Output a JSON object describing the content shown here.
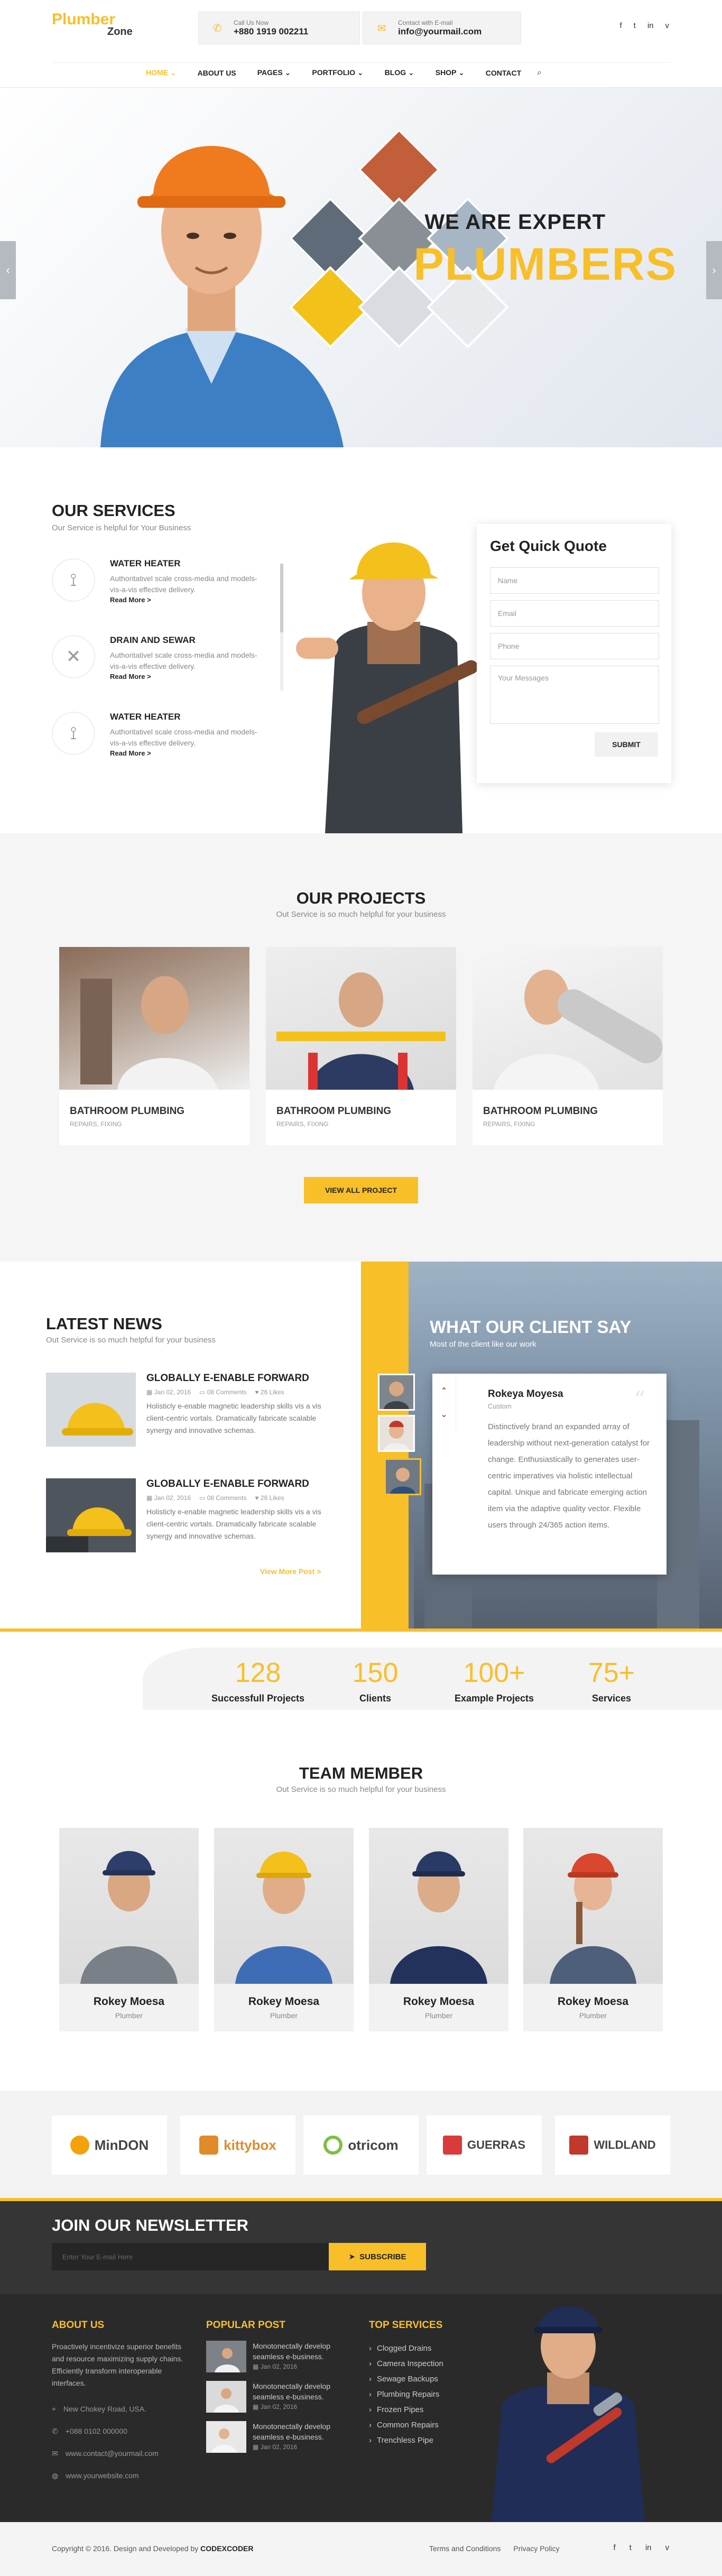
{
  "header": {
    "logo_line1": "Plumber",
    "logo_line2": "Zone",
    "call_label": "Call Us Now",
    "call_value": "+880 1919 002211",
    "mail_label": "Contact with E-mail",
    "mail_value": "info@yourmail.com",
    "social": [
      "f",
      "t",
      "in",
      "v"
    ]
  },
  "nav": {
    "items": [
      "HOME",
      "ABOUT US",
      "PAGES",
      "PORTFOLIO",
      "BLOG",
      "SHOP",
      "CONTACT"
    ],
    "dropdown_marks": [
      "⌄",
      "⌄",
      "⌄",
      "⌄",
      "⌄"
    ]
  },
  "hero": {
    "title_small": "WE ARE EXPERT",
    "title_big": "PLUMBERS",
    "prev": "‹",
    "next": "›"
  },
  "services": {
    "title": "OUR SERVICES",
    "subtitle": "Our Service is helpful for Your Business",
    "items": [
      {
        "title": "WATER HEATER",
        "text": "Authoritativel scale cross-media and models-vis-a-vis effective delivery.",
        "link": "Read More >"
      },
      {
        "title": "DRAIN AND SEWAR",
        "text": "Authoritativel scale cross-media and models-vis-a-vis effective delivery.",
        "link": "Read More >"
      },
      {
        "title": "WATER HEATER",
        "text": "Authoritativel scale cross-media and models-vis-a-vis effective delivery.",
        "link": "Read More >"
      }
    ]
  },
  "quote": {
    "title": "Get Quick Quote",
    "placeholders": [
      "Name",
      "Email",
      "Phone",
      "Your Messages"
    ],
    "submit": "SUBMIT"
  },
  "projects": {
    "title": "OUR PROJECTS",
    "subtitle": "Out Service is so much helpful for your business",
    "items": [
      {
        "title": "BATHROOM PLUMBING",
        "category": "REPAIRS, FIXING"
      },
      {
        "title": "BATHROOM PLUMBING",
        "category": "REPAIRS, FIXING"
      },
      {
        "title": "BATHROOM PLUMBING",
        "category": "REPAIRS, FIXING"
      }
    ],
    "button": "VIEW ALL PROJECT"
  },
  "news": {
    "title": "LATEST NEWS",
    "subtitle": "Out Service is so much helpful for your business",
    "items": [
      {
        "title": "GLOBALLY E-ENABLE FORWARD",
        "date": "Jan 02, 2016",
        "comments": "08 Comments",
        "likes": "26 Likes",
        "text": "Holisticly e-enable magnetic leadership skills vis a vis client-centric vortals. Dramatically fabricate scalable synergy and innovative schemas."
      },
      {
        "title": "GLOBALLY E-ENABLE FORWARD",
        "date": "Jan 02, 2016",
        "comments": "08 Comments",
        "likes": "26 Likes",
        "text": "Holisticly e-enable magnetic leadership skills vis a vis client-centric vortals. Dramatically fabricate scalable synergy and innovative schemas."
      }
    ],
    "view_more": "View More Post >"
  },
  "testimonial": {
    "title": "WHAT OUR CLIENT SAY",
    "subtitle": "Most of the client like our work",
    "name": "Rokeya Moyesa",
    "role": "Custom",
    "text": "Distinctively brand an expanded array of leadership without next-generation catalyst for change. Enthusiastically to generates user-centric imperatives via holistic intellectual capital. Unique and fabricate emerging action item via the adaptive quality vector. Flexible users through 24/365 action items.",
    "quote_mark": "“",
    "up": "⌃",
    "down": "⌄"
  },
  "counters": [
    {
      "number": "128",
      "label": "Successfull Projects"
    },
    {
      "number": "150",
      "label": "Clients"
    },
    {
      "number": "100+",
      "label": "Example Projects"
    },
    {
      "number": "75+",
      "label": "Services"
    }
  ],
  "team": {
    "title": "TEAM MEMBER",
    "subtitle": "Out Service is so much helpful for your business",
    "members": [
      {
        "name": "Rokey Moesa",
        "role": "Plumber"
      },
      {
        "name": "Rokey Moesa",
        "role": "Plumber"
      },
      {
        "name": "Rokey Moesa",
        "role": "Plumber"
      },
      {
        "name": "Rokey Moesa",
        "role": "Plumber"
      }
    ]
  },
  "partners": [
    "MinDON",
    "kittybox",
    "otricom",
    "GUERRAS",
    "WILDLAND"
  ],
  "footer": {
    "newsletter_title": "JOIN OUR NEWSLETTER",
    "newsletter_placeholder": "Enter Your E-mail Here",
    "subscribe": "SUBSCRIBE",
    "about_title": "ABOUT US",
    "about_text": "Proactively incentivize superior benefits and resource maximizing supply chains. Efficiently transform interoperable interfaces.",
    "contact": [
      "New Chokey Road, USA.",
      "+088 0102 000000",
      "www.contact@yourmail.com",
      "www.yourwebsite.com"
    ],
    "popular_title": "POPULAR POST",
    "posts": [
      {
        "title": "Monotonectally develop seamless e-business.",
        "date": "Jan 02, 2016"
      },
      {
        "title": "Monotonectally develop seamless e-business.",
        "date": "Jan 02, 2016"
      },
      {
        "title": "Monotonectally develop seamless e-business.",
        "date": "Jan 02, 2016"
      }
    ],
    "services_title": "TOP SERVICES",
    "services": [
      "Clogged Drains",
      "Camera Inspection",
      "Sewage Backups",
      "Plumbing Repairs",
      "Frozen Pipes",
      "Common Repairs",
      "Trenchless Pipe"
    ],
    "copyright_prefix": "Copyright © 2016. Design and Developed by",
    "copyright_brand": "CODEXCODER",
    "links": [
      "Terms and Conditions",
      "Privacy Policy"
    ],
    "social": [
      "f",
      "t",
      "in",
      "v"
    ]
  },
  "colors": {
    "accent": "#f8bf28",
    "dark": "#2a2a2a"
  }
}
